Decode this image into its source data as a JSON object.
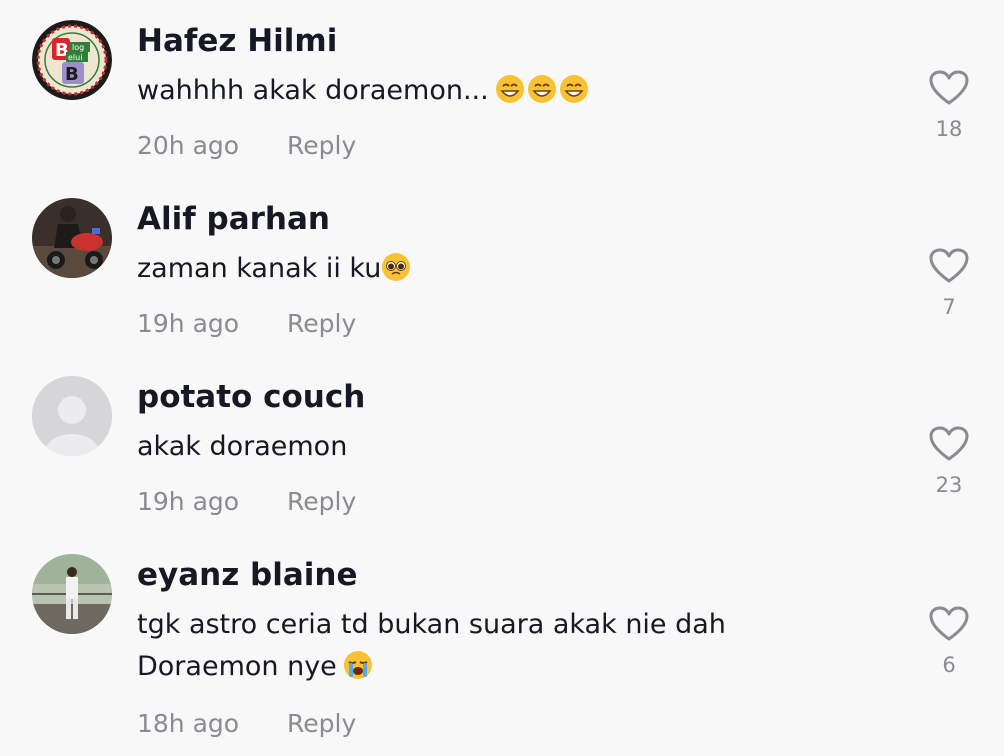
{
  "comments": [
    {
      "username": "Hafez Hilmi",
      "text": "wahhhh akak doraemon...",
      "emoji": [
        "grinning-face-with-smiling-eyes",
        "grinning-face-with-smiling-eyes",
        "grinning-face-with-smiling-eyes"
      ],
      "time": "20h ago",
      "reply": "Reply",
      "likes": "18",
      "avatar": {
        "type": "logo",
        "text": "Blog Belui B"
      }
    },
    {
      "username": "Alif parhan",
      "text": "zaman kanak ii ku",
      "emoji": [
        "pleading-face"
      ],
      "time": "19h ago",
      "reply": "Reply",
      "likes": "7",
      "avatar": {
        "type": "photo"
      }
    },
    {
      "username": "potato couch",
      "text": "akak doraemon",
      "emoji": [],
      "time": "19h ago",
      "reply": "Reply",
      "likes": "23",
      "avatar": {
        "type": "default"
      }
    },
    {
      "username": "eyanz blaine",
      "text": "tgk astro ceria td bukan suara akak nie dah Doraemon nye",
      "emoji": [
        "loudly-crying-face"
      ],
      "time": "18h ago",
      "reply": "Reply",
      "likes": "6",
      "avatar": {
        "type": "photo"
      }
    }
  ],
  "colors": {
    "background": "#f8f8f8",
    "username": "#161823",
    "text": "#161823",
    "meta": "#8a8b91",
    "heart_outline": "#8a8b91"
  },
  "icons": {
    "like": "heart-outline-icon"
  }
}
